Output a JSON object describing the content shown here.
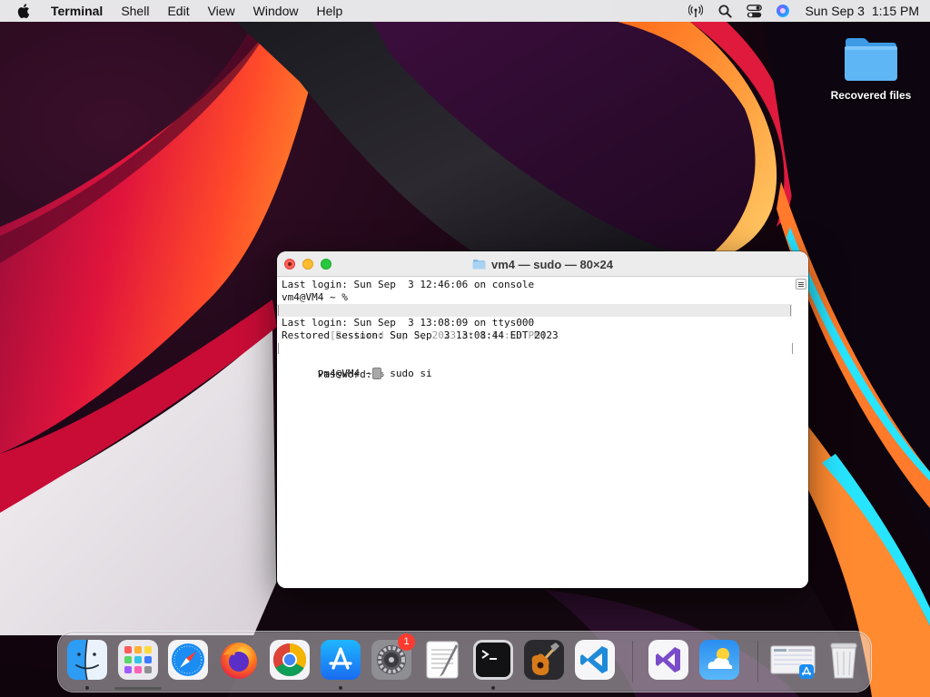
{
  "menubar": {
    "app_name": "Terminal",
    "menus": [
      {
        "label": "Shell"
      },
      {
        "label": "Edit"
      },
      {
        "label": "View"
      },
      {
        "label": "Window"
      },
      {
        "label": "Help"
      }
    ],
    "status_icons": [
      "antenna-icon",
      "search-icon",
      "control-center-icon",
      "siri-icon"
    ],
    "date": "Sun Sep 3",
    "time": "1:15 PM"
  },
  "desktop": {
    "folder_label": "Recovered files"
  },
  "terminal": {
    "title": "vm4 — sudo — 80×24",
    "lines": [
      "Last login: Sun Sep  3 12:46:06 on console",
      "vm4@VM4 ~ %",
      "  [Restored Sep 3, 2023 at 1:14:53 PM]",
      "Last login: Sun Sep  3 13:08:09 on ttys000",
      "Restored session: Sun Sep  3 13:08:44 EDT 2023",
      "vm4@VM4 ~ % sudo si",
      "Password:"
    ]
  },
  "dock": {
    "badge_settings": "1",
    "apps": [
      {
        "icon": "finder-icon",
        "running": true
      },
      {
        "icon": "launchpad-icon",
        "running": false
      },
      {
        "icon": "safari-icon",
        "running": false
      },
      {
        "icon": "firefox-icon",
        "running": false
      },
      {
        "icon": "chrome-icon",
        "running": false
      },
      {
        "icon": "app-store-icon",
        "running": true
      },
      {
        "icon": "system-settings-icon",
        "running": false
      },
      {
        "icon": "textedit-icon",
        "running": false
      },
      {
        "icon": "terminal-icon",
        "running": true
      },
      {
        "icon": "garageband-icon",
        "running": false
      },
      {
        "icon": "vscode-icon",
        "running": false
      },
      {
        "icon": "visual-studio-icon",
        "running": false
      },
      {
        "icon": "weather-icon",
        "running": false
      },
      {
        "icon": "downloads-stack-icon",
        "running": false
      },
      {
        "icon": "trash-icon",
        "running": false
      }
    ]
  },
  "colors": {
    "menubar_bg": "#eeeef0",
    "terminal_bg": "#ffffff",
    "close": "#ff5f57",
    "minimize": "#febc2e",
    "maximize": "#28c840",
    "wallpaper_red": "#e0143c",
    "wallpaper_orange": "#ff7a1a",
    "wallpaper_cyan": "#27e4ff"
  }
}
